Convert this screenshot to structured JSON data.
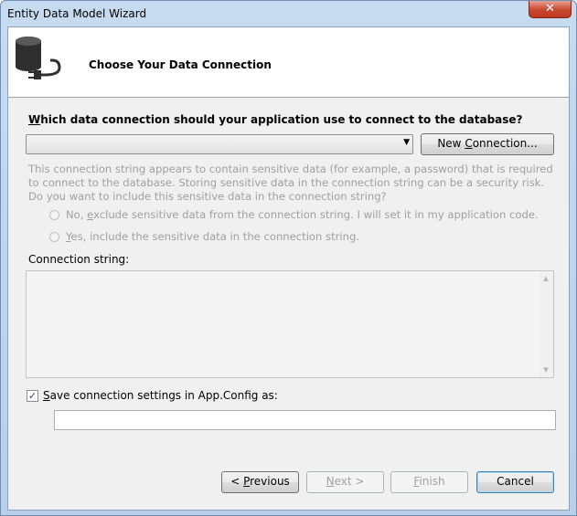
{
  "window": {
    "title": "Entity Data Model Wizard",
    "close_glyph": "✕"
  },
  "header": {
    "title": "Choose Your Data Connection",
    "icon": "database-plug-icon"
  },
  "connection": {
    "question_accel": "W",
    "question_rest": "hich data connection should your application use to connect to the database?",
    "selected": "",
    "new_connection_pre": "New ",
    "new_connection_accel": "C",
    "new_connection_post": "onnection..."
  },
  "sensitive": {
    "info": "This connection string appears to contain sensitive data (for example, a password) that is required to connect to the database. Storing sensitive data in the connection string can be a security risk. Do you want to include this sensitive data in the connection string?",
    "option_no_pre": "No, ",
    "option_no_accel": "e",
    "option_no_post": "xclude sensitive data from the connection string. I will set it in my application code.",
    "option_yes_pre": "",
    "option_yes_accel": "Y",
    "option_yes_post": "es, include the sensitive data in the connection string."
  },
  "connection_string": {
    "label": "Connection string:",
    "value": ""
  },
  "save_settings": {
    "checked": true,
    "check_glyph": "✓",
    "label_accel": "S",
    "label_rest": "ave connection settings in App.Config as:",
    "value": ""
  },
  "buttons": {
    "previous_pre": "< ",
    "previous_accel": "P",
    "previous_post": "revious",
    "next_accel": "N",
    "next_post": "ext >",
    "finish_accel": "F",
    "finish_post": "inish",
    "cancel": "Cancel"
  },
  "colors": {
    "accent": "#3c7fb1",
    "disabled_text": "#a0a0a0",
    "close_red": "#c8472e"
  }
}
